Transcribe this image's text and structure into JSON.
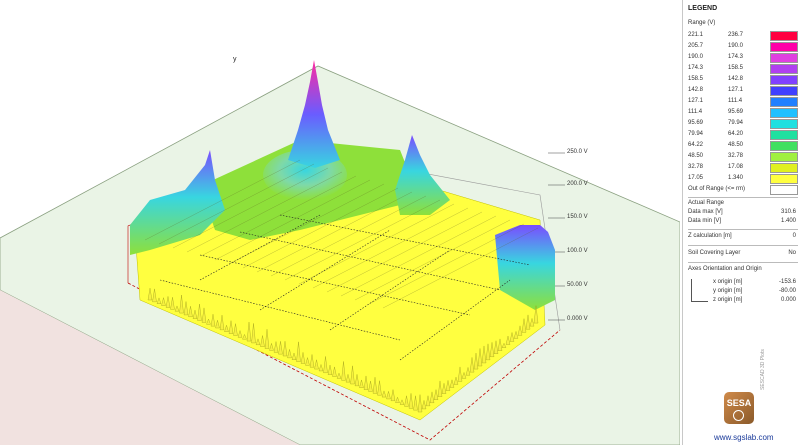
{
  "viewport": {
    "y_axis_label": "y",
    "z_scale_labels": [
      "250.0 V",
      "200.0 V",
      "150.0 V",
      "100.0 V",
      "50.00 V",
      "0.000 V"
    ]
  },
  "legend": {
    "title": "LEGEND",
    "range_header": "Range (V)",
    "rows": [
      {
        "low": "221.1",
        "high": "236.7",
        "color": "#ff0040"
      },
      {
        "low": "205.7",
        "high": "190.0",
        "color": "#ff00a8"
      },
      {
        "low": "190.0",
        "high": "174.3",
        "color": "#e040e0"
      },
      {
        "low": "174.3",
        "high": "158.5",
        "color": "#b040f0"
      },
      {
        "low": "158.5",
        "high": "142.8",
        "color": "#8040ff"
      },
      {
        "low": "142.8",
        "high": "127.1",
        "color": "#4040ff"
      },
      {
        "low": "127.1",
        "high": "111.4",
        "color": "#2080ff"
      },
      {
        "low": "111.4",
        "high": "95.69",
        "color": "#20c0ff"
      },
      {
        "low": "95.69",
        "high": "79.94",
        "color": "#20e0e0"
      },
      {
        "low": "79.94",
        "high": "64.20",
        "color": "#20e0a0"
      },
      {
        "low": "64.22",
        "high": "48.50",
        "color": "#40e060"
      },
      {
        "low": "48.50",
        "high": "32.78",
        "color": "#a0f040"
      },
      {
        "low": "32.78",
        "high": "17.08",
        "color": "#e0f020"
      },
      {
        "low": "17.05",
        "high": "1.340",
        "color": "#ffff40"
      }
    ],
    "out_of_range": {
      "label": "Out of Range (<= rm)",
      "color": "#ffffff"
    },
    "actual_range": "Actual Range",
    "data_max_label": "Data max [V]",
    "data_max": "310.6",
    "data_min_label": "Data min [V]",
    "data_min": "1.400",
    "z_calc_label": "Z calculation [m]",
    "z_calc": "0",
    "soil_layer_label": "Soil Covering Layer",
    "soil_layer": "No",
    "axes_title": "Axes Orientation and Origin",
    "x_origin_label": "x origin [m]",
    "x_origin": "-153.6",
    "y_origin_label": "y origin [m]",
    "y_origin": "-80.00",
    "z_origin_label": "z origin [m]",
    "z_origin": "0.000",
    "footer_note": "SESCAD 3D Plots",
    "brand": "SESA",
    "website": "www.sgslab.com"
  },
  "colors": {
    "ground_fill": "#e9f3e0",
    "soil_edge": "#b7c9a8",
    "frame": "#c00000",
    "peak_high": "#ff2aa0",
    "peak_mid": "#6a5cff",
    "surface_low": "#ffff40",
    "surface_mid": "#8ee03a",
    "surface_cyan": "#38d6e0"
  }
}
